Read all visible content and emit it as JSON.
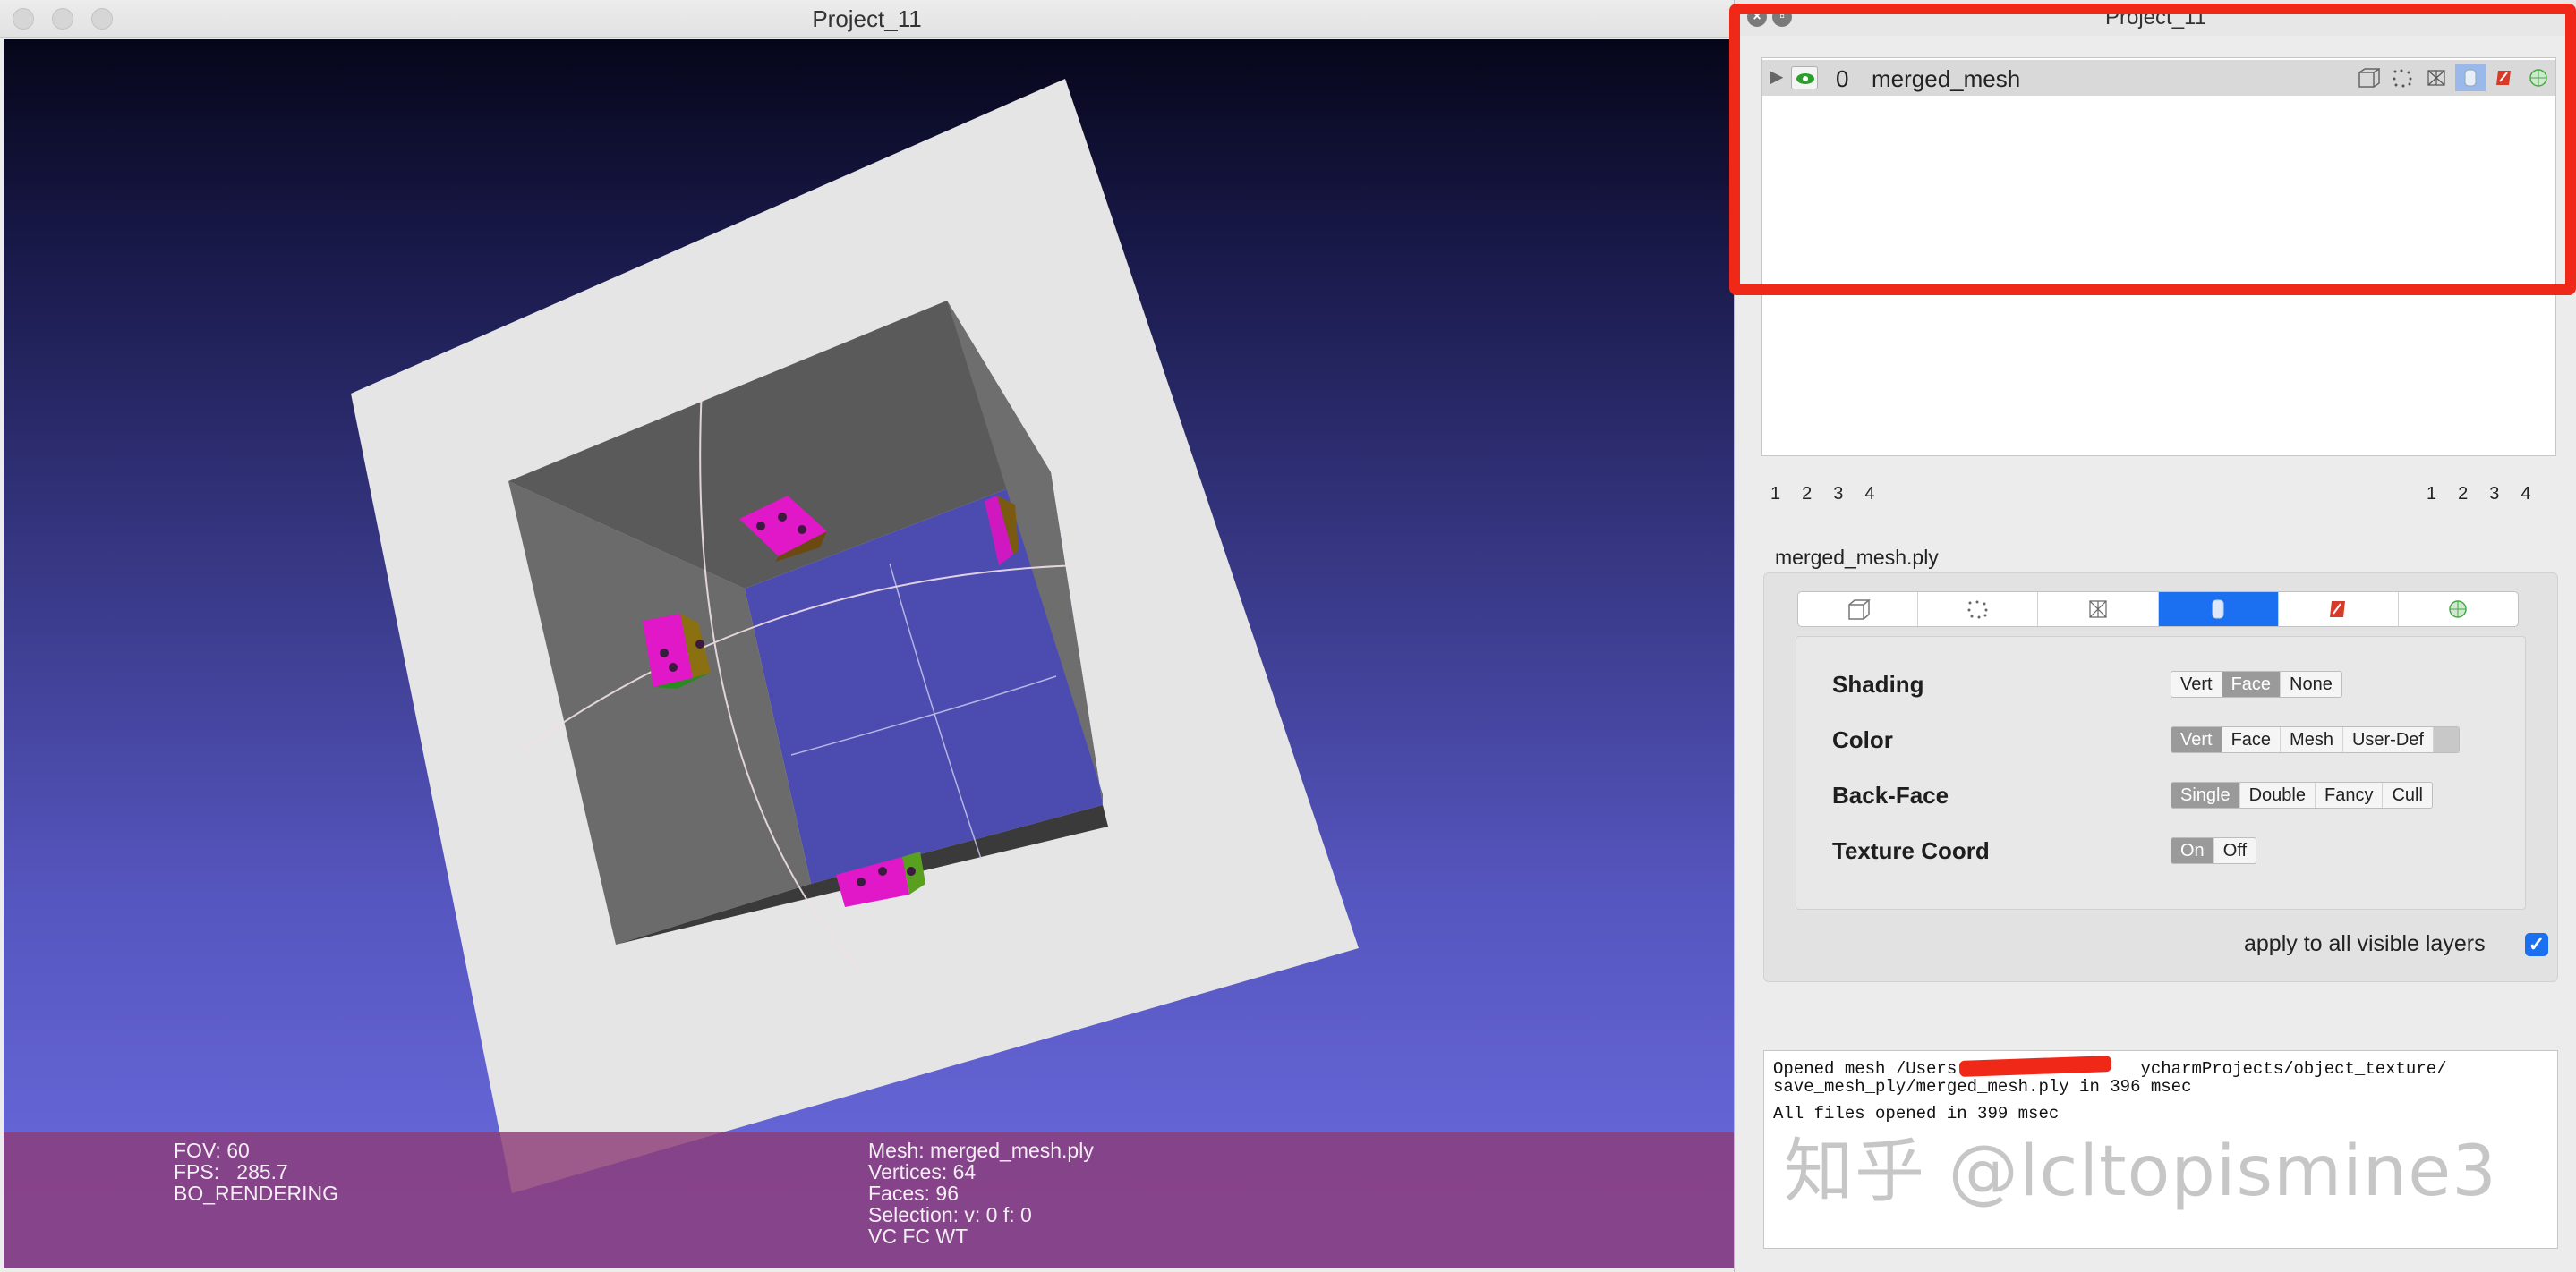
{
  "main_window": {
    "title": "Project_11"
  },
  "viewport": {
    "info_left": {
      "fov": "FOV: 60",
      "fps": "FPS:   285.7",
      "render_mode": "BO_RENDERING"
    },
    "info_right": {
      "mesh": "Mesh: merged_mesh.ply",
      "vertices": "Vertices: 64",
      "faces": "Faces: 96",
      "selection": "Selection: v: 0 f: 0",
      "flags": "VC FC WT"
    }
  },
  "layer_dialog": {
    "title": "Project_11",
    "layers": [
      {
        "index": "0",
        "name": "merged_mesh",
        "visible": true
      }
    ],
    "layer_icons": [
      "box-icon",
      "points-icon",
      "wire-icon",
      "cylinder-icon",
      "texture-icon",
      "sphere-icon"
    ],
    "pages_left": [
      "1",
      "2",
      "3",
      "4"
    ],
    "pages_right": [
      "1",
      "2",
      "3",
      "4"
    ],
    "file_label": "merged_mesh.ply",
    "render_modes": [
      "box-icon",
      "points-icon",
      "wire-icon",
      "smooth-icon",
      "texture-icon",
      "sphere-icon"
    ],
    "options": {
      "shading": {
        "label": "Shading",
        "choices": [
          "Vert",
          "Face",
          "None"
        ],
        "selected": "Face"
      },
      "color": {
        "label": "Color",
        "choices": [
          "Vert",
          "Face",
          "Mesh",
          "User-Def"
        ],
        "selected": "Vert"
      },
      "back_face": {
        "label": "Back-Face",
        "choices": [
          "Single",
          "Double",
          "Fancy",
          "Cull"
        ],
        "selected": "Single"
      },
      "texture_coord": {
        "label": "Texture Coord",
        "choices": [
          "On",
          "Off"
        ],
        "selected": "On"
      }
    },
    "apply_all": "apply to all visible layers",
    "apply_checked": true,
    "log": [
      "Opened mesh /Users                  ycharmProjects/object_texture/",
      "save_mesh_ply/merged_mesh.ply in 396 msec",
      "All files opened in 399 msec"
    ],
    "watermark": "知乎 @lcltopismine3"
  },
  "colors": {
    "highlight": "#f02818",
    "accent": "#1a70f0",
    "info_bar": "#8c3c78"
  }
}
